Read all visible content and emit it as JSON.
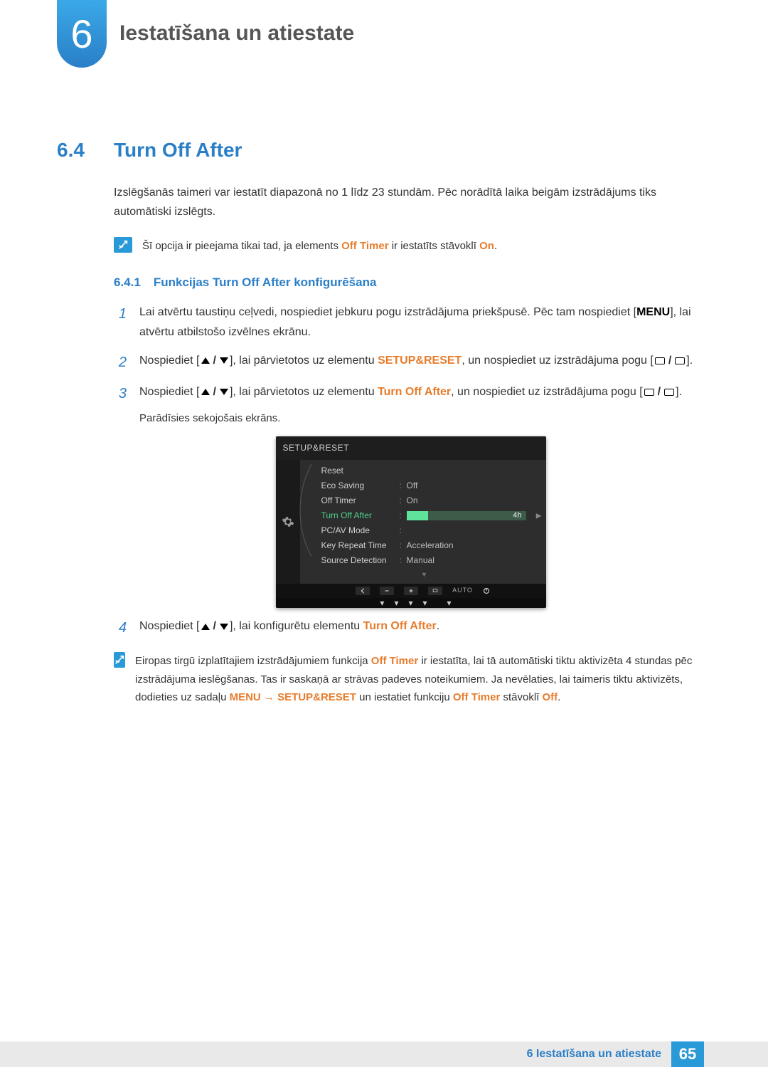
{
  "chapter": {
    "number": "6",
    "title": "Iestatīšana un atiestate"
  },
  "section": {
    "number": "6.4",
    "title": "Turn Off After",
    "intro": "Izslēgšanās taimeri var iestatīt diapazonā no 1 līdz 23 stundām. Pēc norādītā laika beigām izstrādājums tiks automātiski izslēgts."
  },
  "note1": {
    "pre": "Šī opcija ir pieejama tikai tad, ja elements ",
    "hl1": "Off Timer",
    "mid": " ir iestatīts stāvoklī ",
    "hl2": "On",
    "post": "."
  },
  "subsection": {
    "number": "6.4.1",
    "title": "Funkcijas Turn Off After konfigurēšana"
  },
  "steps": {
    "s1": {
      "a": "Lai atvērtu taustiņu ceļvedi, nospiediet jebkuru pogu izstrādājuma priekšpusē. Pēc tam nospiediet [",
      "menu": "MENU",
      "b": "], lai atvērtu atbilstošo izvēlnes ekrānu."
    },
    "s2": {
      "a": "Nospiediet [",
      "b": "], lai pārvietotos uz elementu ",
      "hl": "SETUP&RESET",
      "c": ", un nospiediet uz izstrādājuma pogu [",
      "d": "]."
    },
    "s3": {
      "a": "Nospiediet [",
      "b": "], lai pārvietotos uz elementu ",
      "hl": "Turn Off After",
      "c": ", un nospiediet uz izstrādājuma pogu [",
      "d": "].",
      "caption": "Parādīsies sekojošais ekrāns."
    },
    "s4": {
      "a": "Nospiediet [",
      "b": "], lai konfigurētu elementu ",
      "hl": "Turn Off After",
      "c": "."
    }
  },
  "osd": {
    "title": "SETUP&RESET",
    "rows": [
      {
        "label": "Reset",
        "val": ""
      },
      {
        "label": "Eco Saving",
        "val": "Off"
      },
      {
        "label": "Off Timer",
        "val": "On"
      },
      {
        "label": "Turn Off After",
        "val": "4h",
        "active": true,
        "bar": true
      },
      {
        "label": "PC/AV Mode",
        "val": ""
      },
      {
        "label": "Key Repeat Time",
        "val": "Acceleration"
      },
      {
        "label": "Source Detection",
        "val": "Manual"
      }
    ],
    "auto_label": "AUTO"
  },
  "note2": {
    "a": "Eiropas tirgū izplatītajiem izstrādājumiem funkcija ",
    "hl1": "Off Timer",
    "b": " ir iestatīta, lai tā automātiski tiktu aktivizēta 4 stundas pēc izstrādājuma ieslēgšanas. Tas ir saskaņā ar strāvas padeves noteikumiem. Ja nevēlaties, lai taimeris tiktu aktivizēts, dodieties uz sadaļu ",
    "hl2": "MENU",
    "arrow": " → ",
    "hl3": "SETUP&RESET",
    "c": " un iestatiet funkciju ",
    "hl4": "Off Timer",
    "d": " stāvoklī ",
    "hl5": "Off",
    "e": "."
  },
  "footer": {
    "label": "6 Iestatīšana un atiestate",
    "page": "65"
  }
}
